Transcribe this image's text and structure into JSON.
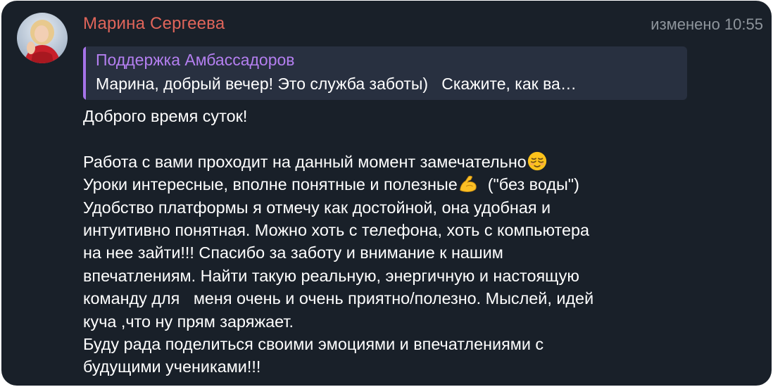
{
  "message": {
    "sender_name": "Марина Сергеева",
    "edited_label": "изменено",
    "time": "10:55",
    "avatar_icon": "user-avatar",
    "reply": {
      "author": "Поддержка Амбассадоров",
      "preview": "Марина, добрый вечер! Это служба заботы)   Скажите, как ва…"
    },
    "lines": [
      "Доброго время суток!",
      "",
      "Работа с вами проходит на данный момент замечательно",
      "Уроки интересные, вполне понятные и полезные",
      "(\"без воды\")",
      "Удобство платформы я отмечу как достойной, она удобная и",
      "интуитивно понятная. Можно хоть с телефона, хоть с компьютера",
      "на нее зайти!!! Спасибо за заботу и внимание к нашим",
      "впечатлениям. Найти такую реальную, энергичную и настоящую",
      "команду для   меня очень и очень приятно/полезно. Мыслей, идей",
      "куча ,что ну прям заряжает.",
      "Буду рада поделиться своими эмоциями и впечатлениями с",
      "будущими учениками!!!"
    ],
    "emojis": {
      "relieved": "relieved-face-emoji",
      "flexed": "flexed-biceps-emoji"
    }
  },
  "colors": {
    "background": "#192029",
    "sender": "#e0655a",
    "reply_accent": "#a673e8",
    "reply_author": "#b47ff0",
    "meta": "#8e959c",
    "text": "#ffffff"
  }
}
